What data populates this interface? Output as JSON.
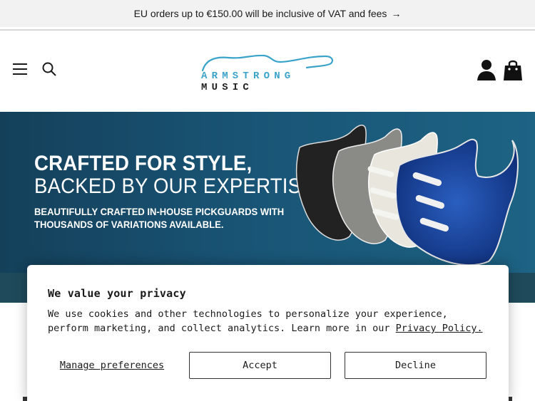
{
  "announcement": {
    "text": "EU orders up to €150.00 will be inclusive of VAT and fees",
    "arrow": "→"
  },
  "header": {
    "logo_part1": "ARMSTRONG",
    "logo_part2": "MUSIC",
    "icons": [
      "menu-icon",
      "search-icon",
      "account-icon",
      "cart-icon"
    ]
  },
  "hero": {
    "title_line1": "CRAFTED FOR STYLE,",
    "title_line2": "BACKED BY OUR EXPERTISE",
    "subtitle_line1": "BEAUTIFULLY CRAFTED IN-HOUSE PICKGUARDS WITH",
    "subtitle_line2": "THOUSANDS OF VARIATIONS AVAILABLE."
  },
  "cookie_banner": {
    "title": "We value your privacy",
    "body": "We use cookies and other technologies to personalize your experience, perform marketing, and collect analytics. Learn more in our ",
    "link": "Privacy Policy.",
    "manage_label": "Manage preferences",
    "accept_label": "Accept",
    "decline_label": "Decline"
  },
  "colors": {
    "hero_bg": "#195475",
    "logo_accent": "#3aa3c9",
    "strip": "#1f4a5b"
  }
}
